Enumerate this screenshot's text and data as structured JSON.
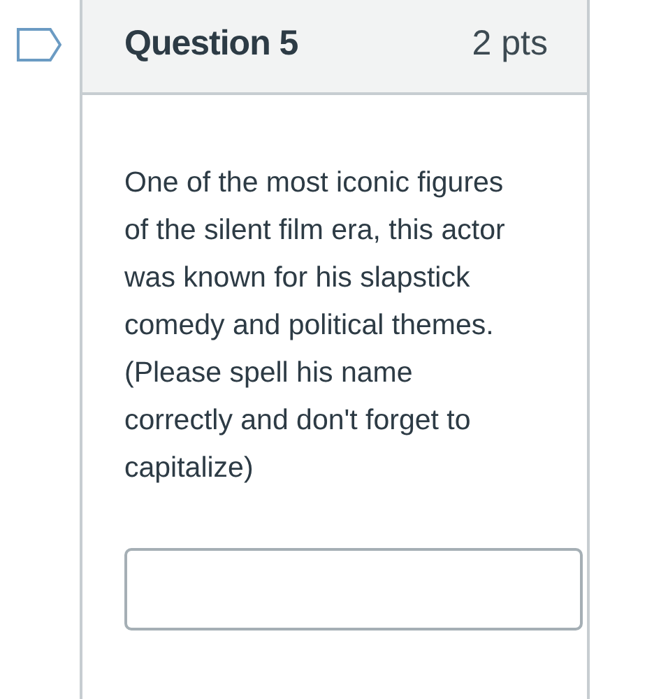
{
  "question": {
    "title": "Question 5",
    "points": "2 pts",
    "flagged": false,
    "text": "One of the most iconic figures of the silent film era, this actor was known for his slapstick comedy and political themes. (Please spell his name correctly and don't forget to capitalize)"
  }
}
